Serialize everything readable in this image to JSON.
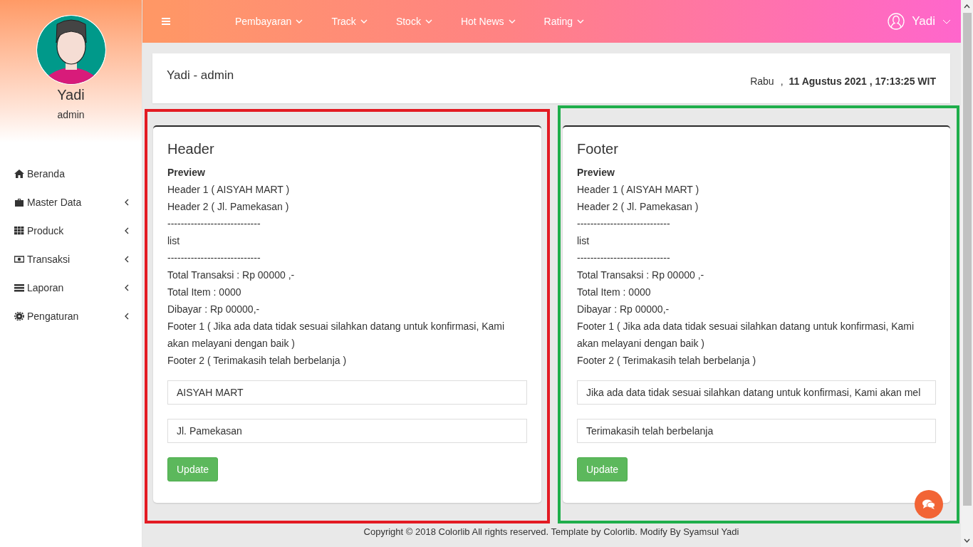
{
  "sidebar": {
    "user": {
      "name": "Yadi",
      "role": "admin"
    },
    "items": [
      {
        "label": "Beranda",
        "has_submenu": false
      },
      {
        "label": "Master Data",
        "has_submenu": true
      },
      {
        "label": "Produck",
        "has_submenu": true
      },
      {
        "label": "Transaksi",
        "has_submenu": true
      },
      {
        "label": "Laporan",
        "has_submenu": true
      },
      {
        "label": "Pengaturan",
        "has_submenu": true
      }
    ]
  },
  "topbar": {
    "menu": [
      "Pembayaran",
      "Track",
      "Stock",
      "Hot News",
      "Rating"
    ],
    "user": "Yadi"
  },
  "title_card": {
    "title": "Yadi - admin",
    "day": "Rabu",
    "separator": ",",
    "datetime": "11 Agustus 2021 , 17:13:25 WIT"
  },
  "panels": [
    {
      "title": "Header",
      "color": "#e31b23",
      "preview_title": "Preview",
      "preview_lines": [
        "Header 1 ( AISYAH MART )",
        "Header 2 ( Jl. Pamekasan )",
        "----------------------------",
        "list",
        "----------------------------",
        "Total Transaksi : Rp 00000 ,-",
        "Total Item : 0000",
        "Dibayar : Rp 00000,-",
        "Footer 1 ( Jika ada data tidak sesuai silahkan datang untuk konfirmasi, Kami akan melayani dengan baik )",
        "Footer 2 ( Terimakasih telah berbelanja )"
      ],
      "fields": [
        "AISYAH MART",
        "Jl. Pamekasan"
      ],
      "button": "Update"
    },
    {
      "title": "Footer",
      "color": "#1fae4b",
      "preview_title": "Preview",
      "preview_lines": [
        "Header 1 ( AISYAH MART )",
        "Header 2 ( Jl. Pamekasan )",
        "----------------------------",
        "list",
        "----------------------------",
        "Total Transaksi : Rp 00000 ,-",
        "Total Item : 0000",
        "Dibayar : Rp 00000,-",
        "Footer 1 ( Jika ada data tidak sesuai silahkan datang untuk konfirmasi, Kami akan melayani dengan baik )",
        "Footer 2 ( Terimakasih telah berbelanja )"
      ],
      "fields": [
        "Jika ada data tidak sesuai silahkan datang untuk konfirmasi, Kami akan mel",
        "Terimakasih telah berbelanja"
      ],
      "button": "Update"
    }
  ],
  "footer": "Copyright © 2018 Colorlib All rights reserved. Template by Colorlib. Modify By Syamsul Yadi"
}
